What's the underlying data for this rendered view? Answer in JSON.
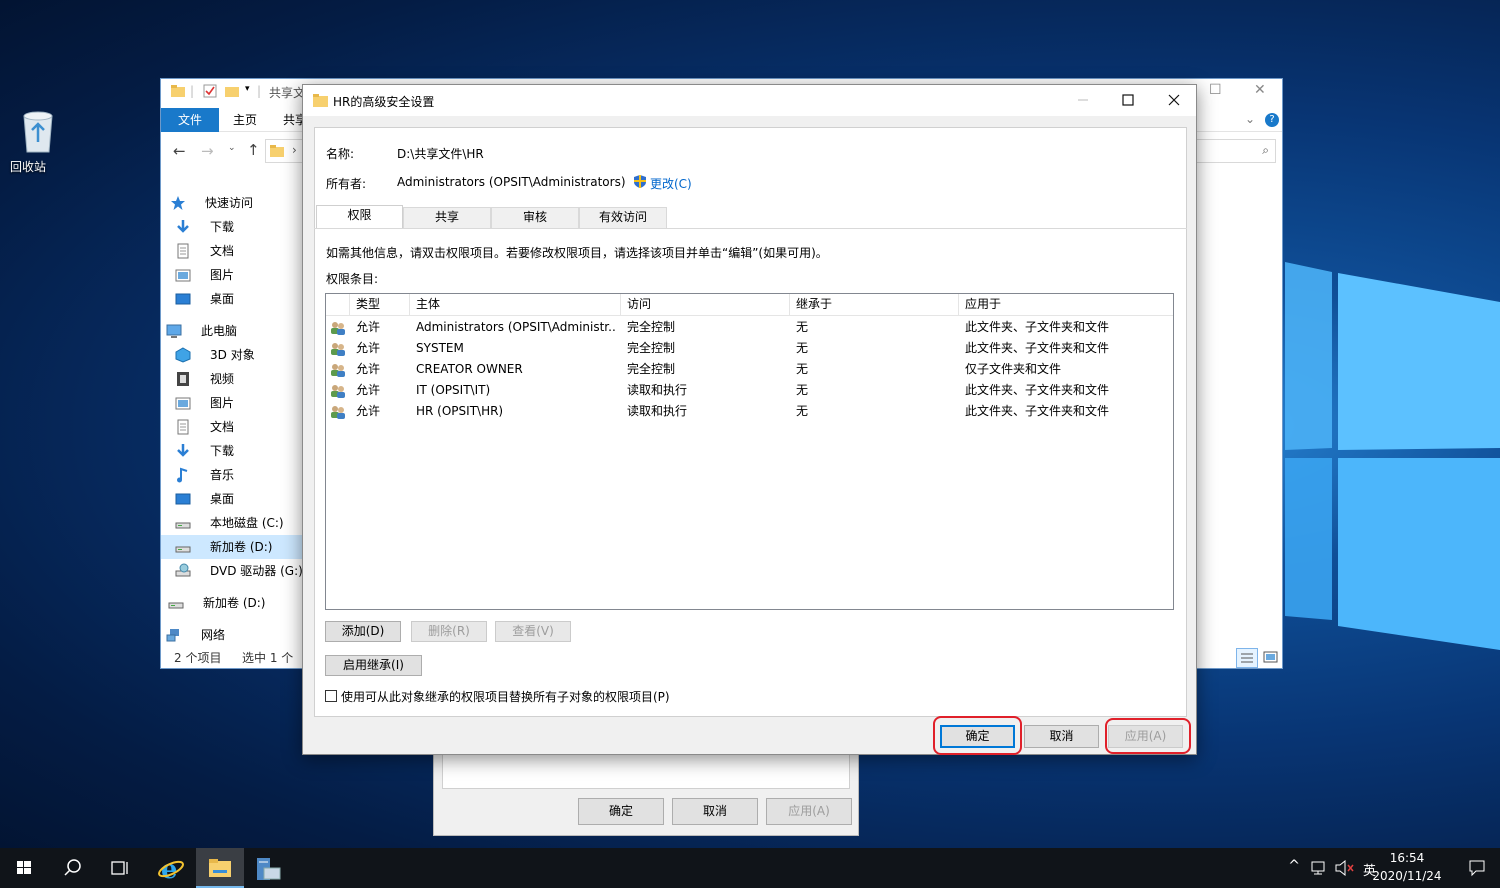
{
  "desktop": {
    "recycle_bin": "回收站"
  },
  "explorer": {
    "title_partial": "共享文",
    "ribbon_tabs": [
      "文件",
      "主页",
      "共享"
    ],
    "nav": [
      {
        "label": "快速访问",
        "icon": "star-icon"
      },
      {
        "label": "下载",
        "icon": "download-icon"
      },
      {
        "label": "文档",
        "icon": "document-icon"
      },
      {
        "label": "图片",
        "icon": "picture-icon"
      },
      {
        "label": "桌面",
        "icon": "desktop-icon"
      },
      {
        "label": "此电脑",
        "icon": "computer-icon"
      },
      {
        "label": "3D 对象",
        "icon": "cube-icon"
      },
      {
        "label": "视频",
        "icon": "video-icon"
      },
      {
        "label": "图片",
        "icon": "picture-icon"
      },
      {
        "label": "文档",
        "icon": "document-icon"
      },
      {
        "label": "下载",
        "icon": "download-icon"
      },
      {
        "label": "音乐",
        "icon": "music-icon"
      },
      {
        "label": "桌面",
        "icon": "desktop-icon"
      },
      {
        "label": "本地磁盘 (C:)",
        "icon": "drive-icon"
      },
      {
        "label": "新加卷 (D:)",
        "icon": "drive-icon"
      },
      {
        "label": "DVD 驱动器 (G:)",
        "icon": "dvd-icon"
      },
      {
        "label": "新加卷 (D:)",
        "icon": "drive-icon"
      },
      {
        "label": "网络",
        "icon": "network-icon"
      }
    ],
    "status_items": "2 个项目",
    "status_selected": "选中 1 个"
  },
  "advanced": {
    "title": "HR的高级安全设置",
    "name_label": "名称:",
    "name_value": "D:\\共享文件\\HR",
    "owner_label": "所有者:",
    "owner_value": "Administrators (OPSIT\\Administrators)",
    "change_link": "更改(C)",
    "tabs": [
      "权限",
      "共享",
      "审核",
      "有效访问"
    ],
    "info_text": "如需其他信息，请双击权限项目。若要修改权限项目，请选择该项目并单击“编辑”(如果可用)。",
    "entries_label": "权限条目:",
    "columns": [
      "类型",
      "主体",
      "访问",
      "继承于",
      "应用于"
    ],
    "rows": [
      [
        "允许",
        "Administrators (OPSIT\\Administr...",
        "完全控制",
        "无",
        "此文件夹、子文件夹和文件"
      ],
      [
        "允许",
        "SYSTEM",
        "完全控制",
        "无",
        "此文件夹、子文件夹和文件"
      ],
      [
        "允许",
        "CREATOR OWNER",
        "完全控制",
        "无",
        "仅子文件夹和文件"
      ],
      [
        "允许",
        "IT (OPSIT\\IT)",
        "读取和执行",
        "无",
        "此文件夹、子文件夹和文件"
      ],
      [
        "允许",
        "HR (OPSIT\\HR)",
        "读取和执行",
        "无",
        "此文件夹、子文件夹和文件"
      ]
    ],
    "btn_add": "添加(D)",
    "btn_remove": "删除(R)",
    "btn_view": "查看(V)",
    "btn_inherit": "启用继承(I)",
    "replace_checkbox": "使用可从此对象继承的权限项目替换所有子对象的权限项目(P)",
    "btn_ok": "确定",
    "btn_cancel": "取消",
    "btn_apply": "应用(A)"
  },
  "props": {
    "ok": "确定",
    "cancel": "取消",
    "apply": "应用(A)"
  },
  "taskbar": {
    "ime": "英",
    "time": "16:54",
    "date": "2020/11/24"
  },
  "colors": {
    "accent": "#1979ca",
    "highlight_ring": "#e0202a",
    "taskbar": "#101419"
  }
}
